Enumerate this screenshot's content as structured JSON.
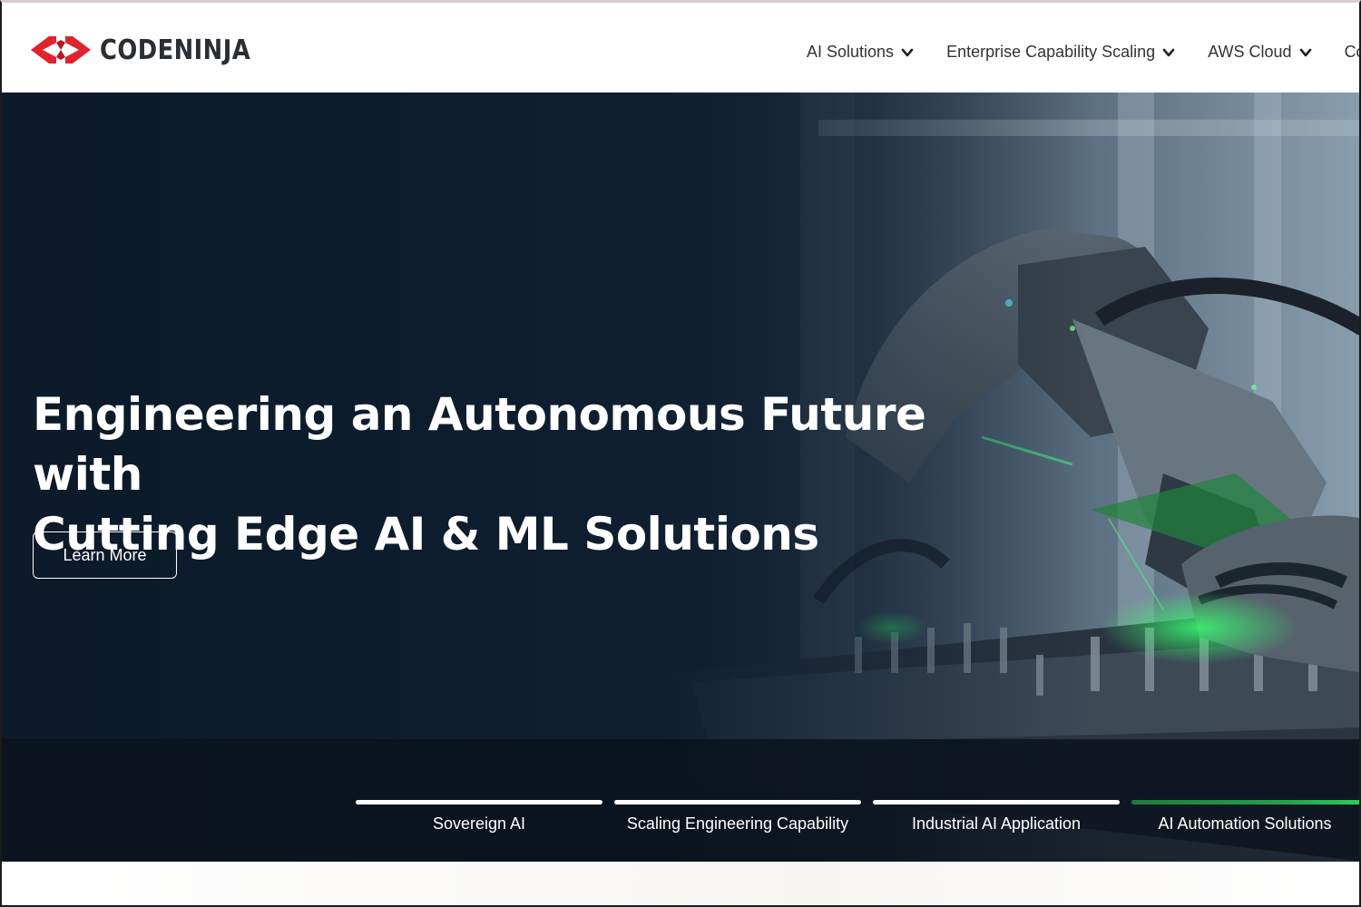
{
  "brand": {
    "name": "CODENINJA",
    "accent_color": "#e0232e",
    "logo_icon": "angle-brackets-logo"
  },
  "nav": {
    "items": [
      {
        "label": "AI Solutions",
        "icon": "chevron-down-icon"
      },
      {
        "label": "Enterprise Capability Scaling",
        "icon": "chevron-down-icon"
      },
      {
        "label": "AWS Cloud",
        "icon": "chevron-down-icon"
      },
      {
        "label": "Co",
        "icon": ""
      }
    ]
  },
  "hero": {
    "title_line1": "Engineering an Autonomous Future with",
    "title_line2": "Cutting Edge AI & ML Solutions",
    "cta_label": "Learn More",
    "background": "robotic-arm-factory-image"
  },
  "tabs": {
    "active_index": 3,
    "active_color": "#23a04a",
    "items": [
      {
        "label": "Sovereign AI"
      },
      {
        "label": "Scaling Engineering Capability"
      },
      {
        "label": "Industrial AI Application"
      },
      {
        "label": "AI Automation Solutions"
      }
    ]
  }
}
